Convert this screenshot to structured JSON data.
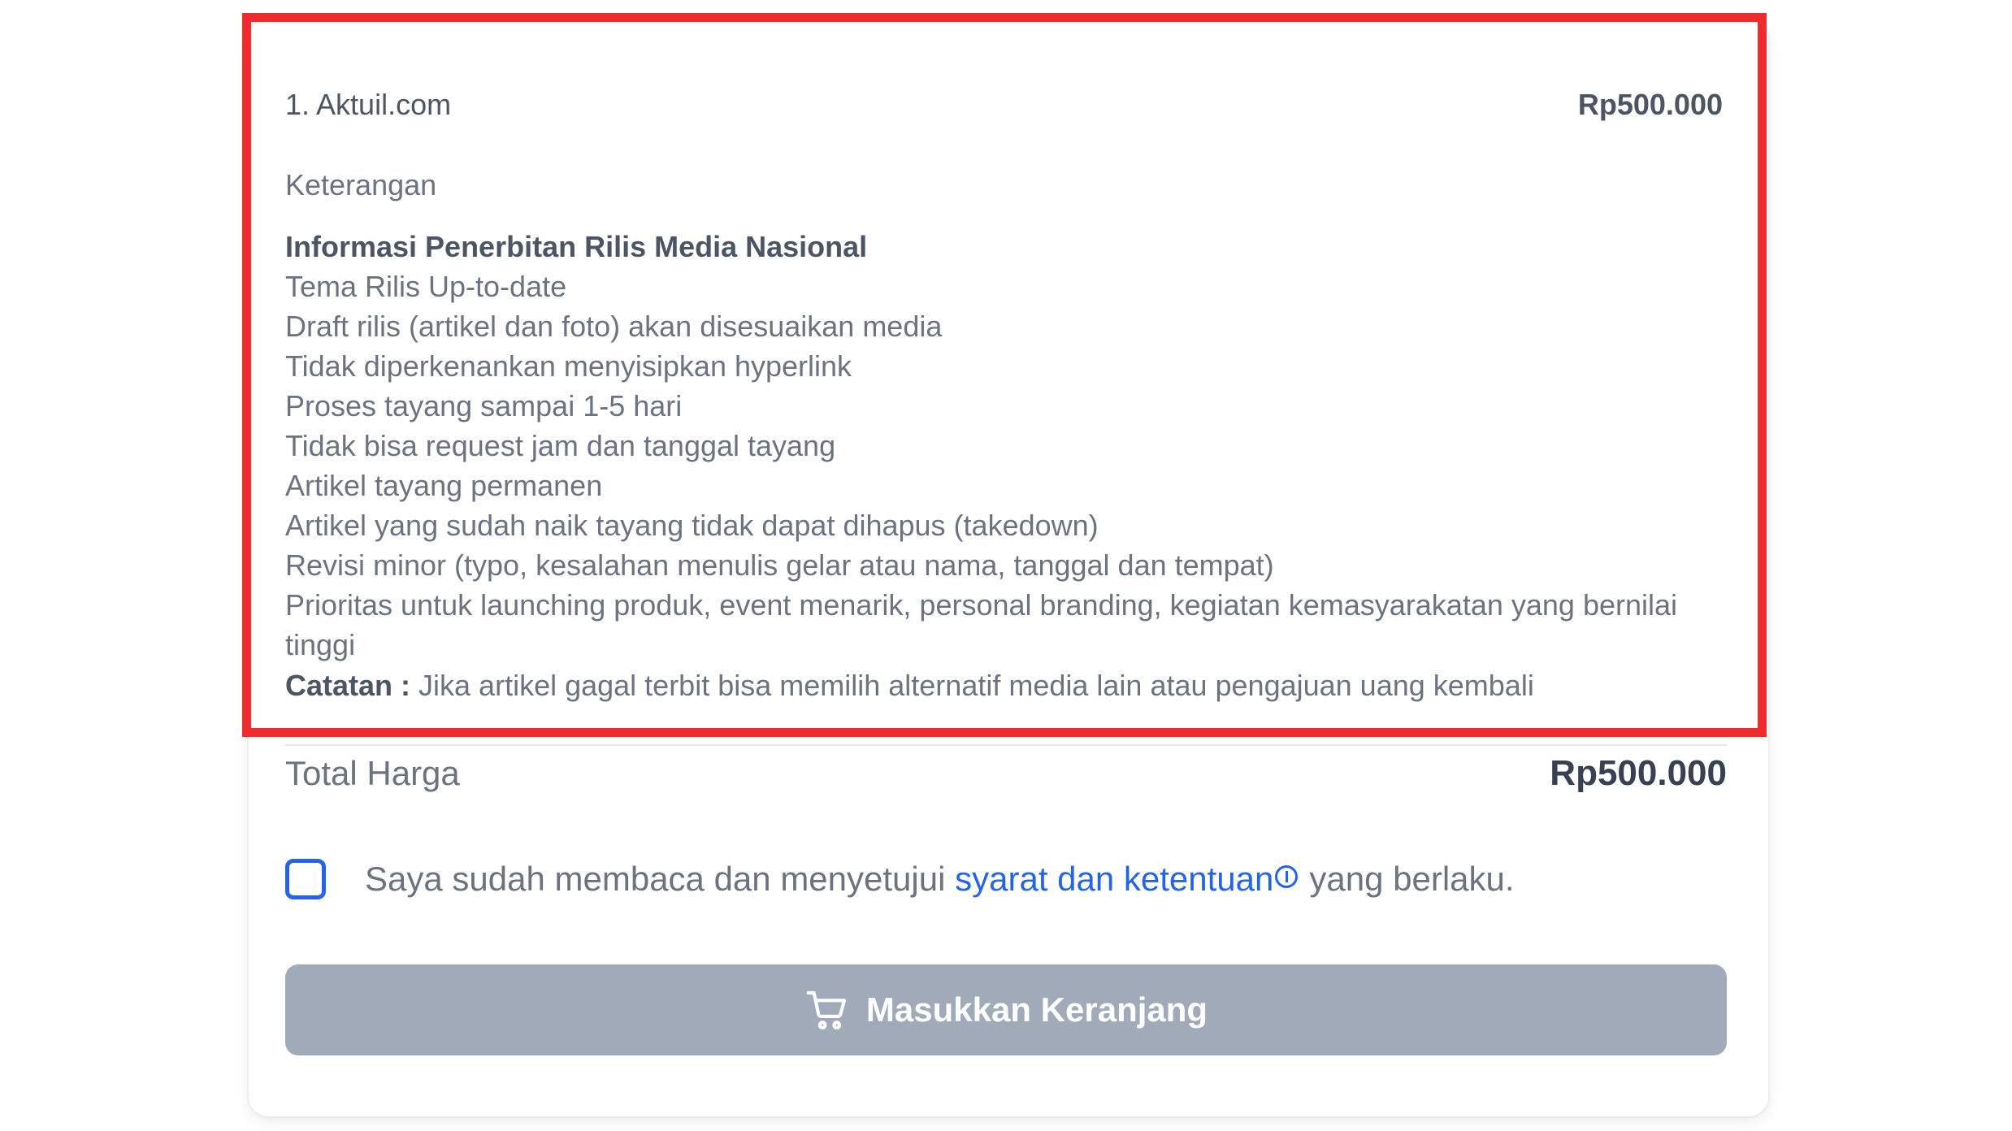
{
  "item": {
    "name": "1. Aktuil.com",
    "price": "Rp500.000",
    "description_label": "Keterangan",
    "details": [
      "Informasi Penerbitan Rilis Media Nasional",
      "Tema Rilis Up-to-date",
      "Draft rilis (artikel dan foto) akan disesuaikan media",
      "Tidak diperkenankan menyisipkan hyperlink",
      "Proses tayang sampai 1-5 hari",
      "Tidak bisa request jam dan tanggal tayang",
      "Artikel tayang permanen",
      "Artikel yang sudah naik tayang tidak dapat dihapus (takedown)",
      "Revisi minor (typo, kesalahan menulis gelar atau nama, tanggal dan tempat)",
      "Prioritas untuk launching produk, event menarik, personal branding, kegiatan kemasyarakatan yang bernilai tinggi"
    ],
    "note_label": "Catatan :",
    "note_text": " Jika artikel gagal terbit bisa memilih alternatif media lain atau pengajuan uang kembali"
  },
  "total": {
    "label": "Total Harga",
    "value": "Rp500.000"
  },
  "agreement": {
    "text_before": "Saya sudah membaca dan menyetujui ",
    "link_text": "syarat dan ketentuan",
    "text_after": "yang berlaku.",
    "checked": false
  },
  "cart_button": {
    "label": "Masukkan Keranjang",
    "icon": "cart-icon",
    "disabled_color": "#a1aab8"
  },
  "colors": {
    "highlight_border": "#ef2b2d",
    "link": "#2563eb"
  }
}
